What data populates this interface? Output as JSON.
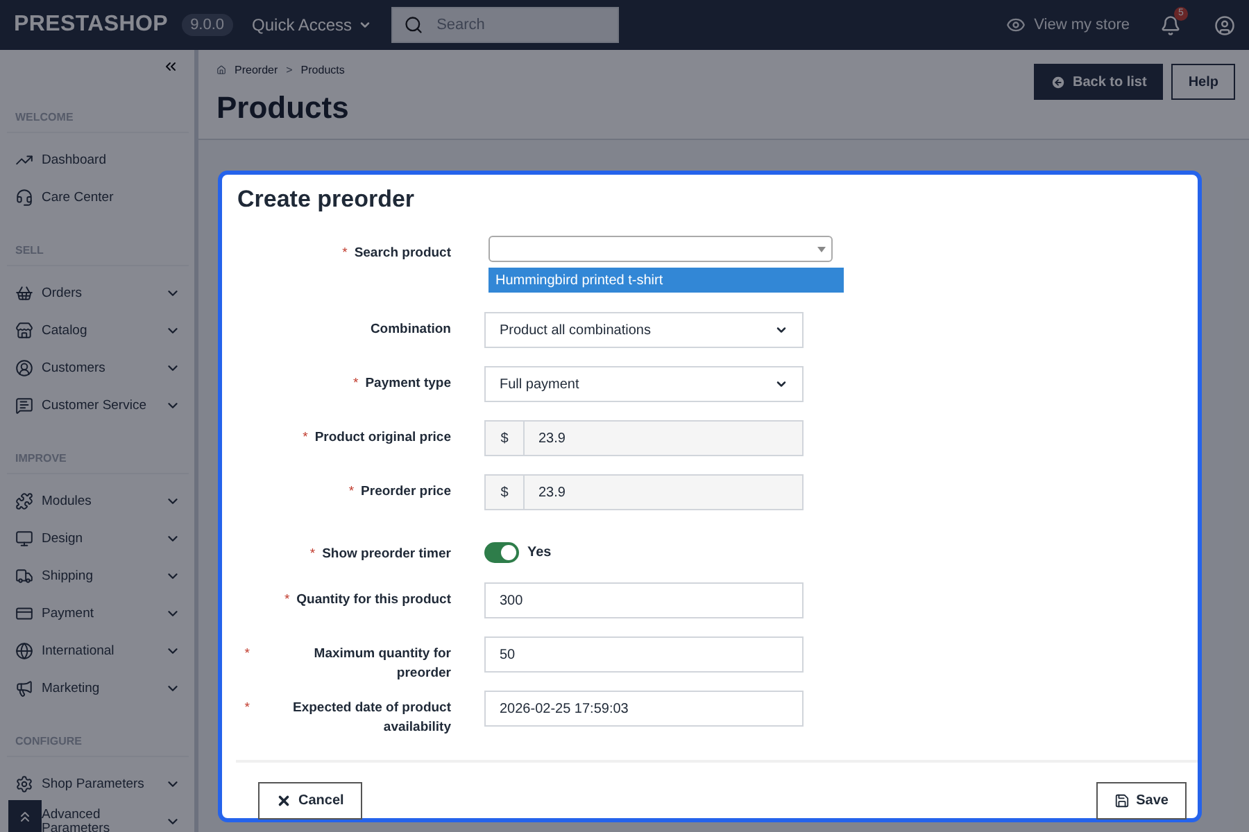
{
  "topbar": {
    "logo": "PRESTASHOP",
    "version": "9.0.0",
    "quick_access": "Quick Access",
    "search": {
      "placeholder": "Search"
    },
    "view_store": "View my store",
    "notifications": "5"
  },
  "sidebar": {
    "sections": [
      {
        "heading": "WELCOME",
        "items": [
          {
            "label": "Dashboard",
            "expandable": false
          },
          {
            "label": "Care Center",
            "expandable": false
          }
        ]
      },
      {
        "heading": "SELL",
        "items": [
          {
            "label": "Orders",
            "expandable": true
          },
          {
            "label": "Catalog",
            "expandable": true
          },
          {
            "label": "Customers",
            "expandable": true
          },
          {
            "label": "Customer Service",
            "expandable": true
          }
        ]
      },
      {
        "heading": "IMPROVE",
        "items": [
          {
            "label": "Modules",
            "expandable": true
          },
          {
            "label": "Design",
            "expandable": true
          },
          {
            "label": "Shipping",
            "expandable": true
          },
          {
            "label": "Payment",
            "expandable": true
          },
          {
            "label": "International",
            "expandable": true
          },
          {
            "label": "Marketing",
            "expandable": true
          }
        ]
      },
      {
        "heading": "CONFIGURE",
        "items": [
          {
            "label": "Shop Parameters",
            "expandable": true
          },
          {
            "label": "Advanced Parameters",
            "expandable": true
          }
        ]
      }
    ]
  },
  "breadcrumb": {
    "separator": ">",
    "items": [
      "Preorder",
      "Products"
    ]
  },
  "title": "Products",
  "header_buttons": [
    {
      "label": "Back to list",
      "kind": "primary"
    },
    {
      "label": "Help",
      "kind": "outline"
    }
  ],
  "modal": {
    "title": "Create preorder",
    "fields": [
      {
        "label": "Search product",
        "required_mark": "*",
        "kind": "search-select",
        "options": [
          {
            "label": "Hummingbird printed t-shirt",
            "selected": true
          }
        ]
      },
      {
        "label": "Combination",
        "kind": "select",
        "value": "Product all combinations"
      },
      {
        "label": "Payment type",
        "required_mark": "*",
        "kind": "select",
        "value": "Full payment"
      },
      {
        "label": "Product original price",
        "required_mark": "*",
        "kind": "price",
        "currency": "$",
        "value": "23.9"
      },
      {
        "label": "Preorder price",
        "required_mark": "*",
        "kind": "price",
        "currency": "$",
        "value": "23.9"
      },
      {
        "label": "Show preorder timer",
        "required_mark": "*",
        "kind": "toggle",
        "on": true,
        "value": "Yes"
      },
      {
        "label": "Quantity for this product",
        "required_mark": "*",
        "kind": "text",
        "value": "300"
      },
      {
        "label": "Maximum quantity for preorder",
        "required_mark": "*",
        "kind": "text",
        "value": "50"
      },
      {
        "label": "Expected date of product availability",
        "required_mark": "*",
        "kind": "text",
        "value": "2026-02-25 17:59:03"
      }
    ],
    "cancel": "Cancel",
    "save": "Save"
  }
}
